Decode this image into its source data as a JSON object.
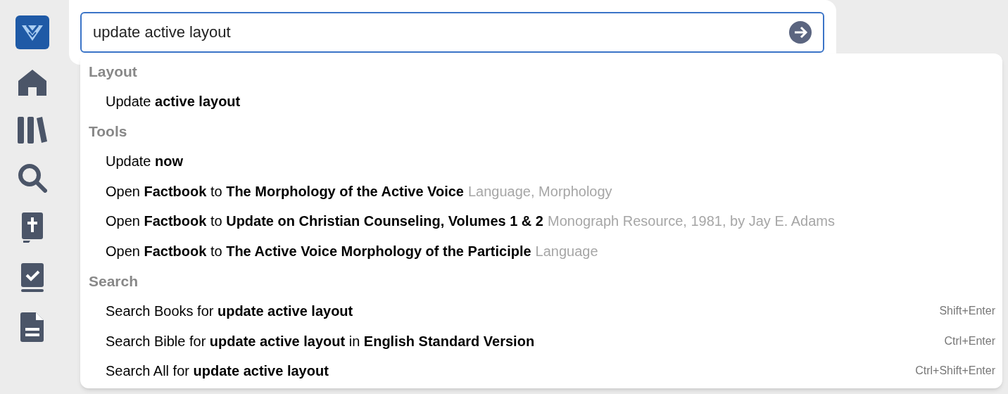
{
  "sidebar": {
    "items": [
      {
        "kind": "logo"
      },
      {
        "kind": "home"
      },
      {
        "kind": "library"
      },
      {
        "kind": "search"
      },
      {
        "kind": "bible"
      },
      {
        "kind": "checklist"
      },
      {
        "kind": "document"
      }
    ]
  },
  "search": {
    "value": "update active layout"
  },
  "suggestions": {
    "sections": [
      {
        "title": "Layout",
        "items": [
          {
            "text": "Update **active layout**"
          }
        ]
      },
      {
        "title": "Tools",
        "items": [
          {
            "text": "Update **now**"
          },
          {
            "text": "Open **Factbook** to **The Morphology of the Active Voice**",
            "detail": "Language, Morphology"
          },
          {
            "text": "Open **Factbook** to **Update on Christian Counseling, Volumes 1 & 2**",
            "detail": "Monograph Resource, 1981, by Jay E. Adams"
          },
          {
            "text": "Open **Factbook** to **The Active Voice Morphology of the Participle**",
            "detail": "Language"
          }
        ]
      },
      {
        "title": "Search",
        "items": [
          {
            "text": "Search Books for **update active layout**",
            "shortcut": "Shift+Enter"
          },
          {
            "text": "Search Bible for **update active layout** in **English Standard Version**",
            "shortcut": "Ctrl+Enter"
          },
          {
            "text": "Search All for **update active layout**",
            "shortcut": "Ctrl+Shift+Enter"
          }
        ]
      }
    ]
  }
}
